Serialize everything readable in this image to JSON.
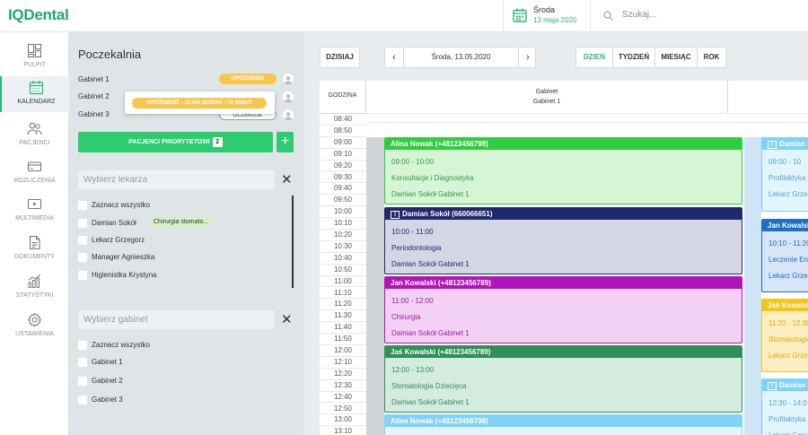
{
  "app": {
    "logo": "IQDental"
  },
  "topbar": {
    "day": "Środa",
    "date": "13 maja 2020",
    "search_placeholder": "Szukaj..."
  },
  "sidebar": {
    "items": [
      {
        "label": "PULPIT",
        "icon": "dashboard-icon"
      },
      {
        "label": "KALENDARZ",
        "icon": "calendar-icon",
        "active": true
      },
      {
        "label": "PACJENCI",
        "icon": "patients-icon"
      },
      {
        "label": "ROZLICZENIA",
        "icon": "billing-icon"
      },
      {
        "label": "MULTIMEDIA",
        "icon": "multimedia-icon"
      },
      {
        "label": "DOKUMENTY",
        "icon": "documents-icon"
      },
      {
        "label": "STATYSTYKI",
        "icon": "statistics-icon"
      },
      {
        "label": "USTAWIENIA",
        "icon": "settings-icon"
      }
    ]
  },
  "waiting": {
    "title": "Poczekalnia",
    "rooms": [
      {
        "name": "Gabinet 1",
        "status": "OPÓŹNIENIE"
      },
      {
        "name": "Gabinet 2",
        "status": ""
      },
      {
        "name": "Gabinet 3",
        "status": "OCZEKUJE"
      }
    ],
    "tooltip": "OPÓŹNIENIE - ALINA NOWAK - 15 MINUT",
    "priority_label": "PACJENCI PRIORYTETOWI",
    "priority_count": "2",
    "add_label": "+",
    "doctor_placeholder": "Wybierz lekarza",
    "doctors": [
      "Zaznacz wszystko",
      "Damian Sokół",
      "Lekarz Grzegorz",
      "Manager Agnieszka",
      "Higienistka Krystyna"
    ],
    "doctor_tag": "Chirurgia stomato...",
    "room_placeholder": "Wybierz gabinet",
    "room_options": [
      "Zaznacz wszystko",
      "Gabinet 1",
      "Gabinet 2",
      "Gabinet 3"
    ]
  },
  "calendar": {
    "today_label": "DZISIAJ",
    "current_date": "Środa, 13.05.2020",
    "prev": "‹",
    "next": "›",
    "views": [
      "DZIEŃ",
      "TYDZIEŃ",
      "MIESIĄC",
      "ROK"
    ],
    "active_view": "DZIEŃ",
    "time_header": "GODZINA",
    "column_title": "Gabinet",
    "column_sub": "Gabinet 1",
    "slots": [
      "08:40",
      "08:50",
      "09:00",
      "09:10",
      "09:20",
      "09:30",
      "09:40",
      "09:50",
      "10:00",
      "10:10",
      "10:20",
      "10:30",
      "10:40",
      "10:50",
      "11:00",
      "11:10",
      "11:20",
      "11:30",
      "11:40",
      "11:50",
      "12:00",
      "12:10",
      "12:20",
      "12:30",
      "12:40",
      "12:50",
      "13:00",
      "13:10"
    ],
    "appointments": [
      {
        "header": "Alina Nowak (+48123456798)",
        "time": "09:00 - 10:00",
        "service": "Konsultacje i Diagnostyka",
        "doctor": "Damian Sokół Gabinet 1",
        "head": "#2ecc40",
        "bg": "#d5f5d5",
        "fg": "#2ea043",
        "alert": false
      },
      {
        "header": "Damian Sokół (660066651)",
        "time": "10:00 - 11:00",
        "service": "Periodontologia",
        "doctor": "Damian Sokół Gabinet 1",
        "head": "#1f2a6e",
        "bg": "#d5d6e4",
        "fg": "#1f2a6e",
        "alert": true
      },
      {
        "header": "Jan Kowalski (+48123456789)",
        "time": "11:00 - 12:00",
        "service": "Chirurgia",
        "doctor": "Damian Sokół Gabinet 1",
        "head": "#b114b8",
        "bg": "#f2d1f5",
        "fg": "#9a19a2",
        "alert": false
      },
      {
        "header": "Jaś Kowalski (+48123456789)",
        "time": "12:00 - 13:00",
        "service": "Stomatologia Dziecięca",
        "doctor": "Damian Sokół Gabinet 1",
        "head": "#2f8f5b",
        "bg": "#d3ecdd",
        "fg": "#2f8f5b",
        "alert": false
      },
      {
        "header": "Alina Nowak (+48123456798)",
        "time": "",
        "service": "",
        "doctor": "",
        "head": "#7fd3f7",
        "bg": "#e2f4fc",
        "fg": "#4aa8d8",
        "alert": false
      }
    ],
    "appointments2": [
      {
        "header": "Damian Sokó",
        "time": "09:00 - 10",
        "service": "Profilaktyka i W",
        "doctor": "Lekarz Grzegor",
        "head": "#7fd3f7",
        "bg": "#e2f4fc",
        "fg": "#4aa8d8",
        "alert": true
      },
      {
        "header": "Jan Kowalski",
        "time": "10:10 - 11:20",
        "service": "Leczenie Endoc",
        "doctor": "Lekarz Grzegor",
        "head": "#1f6fc4",
        "bg": "#d6e6f6",
        "fg": "#1f6fc4",
        "alert": false
      },
      {
        "header": "Jaś Kowalski",
        "time": "11:20 - 12:30",
        "service": "Stomatologia Z",
        "doctor": "Lekarz Grzegor",
        "head": "#f5c518",
        "bg": "#fcf0c2",
        "fg": "#e0a800",
        "alert": false
      },
      {
        "header": "Damian Sokó",
        "time": "12:30 - 14:0",
        "service": "Profilaktyka i W",
        "doctor": "Lekarz Grzegor",
        "head": "#7fd3f7",
        "bg": "#e2f4fc",
        "fg": "#4aa8d8",
        "alert": true
      }
    ]
  },
  "colors": {
    "accent": "#2bb673",
    "priority": "#2ecc71",
    "delay": "#f8c64d"
  }
}
